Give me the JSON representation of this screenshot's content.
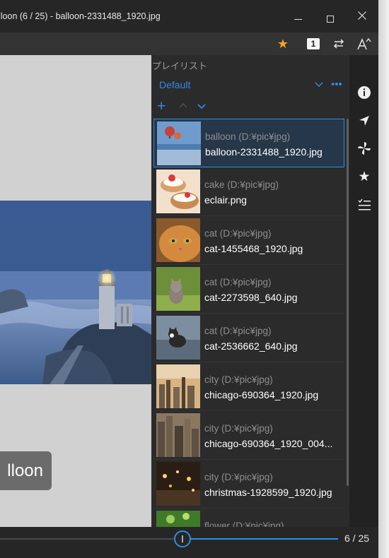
{
  "window": {
    "title": "lloon (6 / 25) - balloon-2331488_1920.jpg"
  },
  "toolbar": {
    "star_icon": "star-icon",
    "page_mode_label": "1",
    "swap_icon": "swap-direction-icon",
    "font_icon": "font-size-icon"
  },
  "viewer": {
    "caption": "lloon"
  },
  "playlist": {
    "title": "プレイリスト",
    "selected_list": "Default",
    "more_label": "•••",
    "add_label": "+",
    "items": [
      {
        "folder": "balloon (D:¥pic¥jpg)",
        "name": "balloon-2331488_1920.jpg",
        "selected": true
      },
      {
        "folder": "cake (D:¥pic¥jpg)",
        "name": "eclair.png",
        "selected": false
      },
      {
        "folder": "cat (D:¥pic¥jpg)",
        "name": "cat-1455468_1920.jpg",
        "selected": false
      },
      {
        "folder": "cat (D:¥pic¥jpg)",
        "name": "cat-2273598_640.jpg",
        "selected": false
      },
      {
        "folder": "cat (D:¥pic¥jpg)",
        "name": "cat-2536662_640.jpg",
        "selected": false
      },
      {
        "folder": "city (D:¥pic¥jpg)",
        "name": "chicago-690364_1920.jpg",
        "selected": false
      },
      {
        "folder": "city (D:¥pic¥jpg)",
        "name": "chicago-690364_1920_004...",
        "selected": false
      },
      {
        "folder": "city (D:¥pic¥jpg)",
        "name": "christmas-1928599_1920.jpg",
        "selected": false
      },
      {
        "folder": "flower (D:¥pic¥jpg)",
        "name": "",
        "selected": false
      }
    ]
  },
  "sidebar": {
    "icons": [
      "info-icon",
      "navigate-icon",
      "pinwheel-icon",
      "favorite-star-icon",
      "checklist-icon"
    ]
  },
  "slider": {
    "current": 6,
    "total": 25,
    "page_label": "6 / 25"
  },
  "colors": {
    "accent": "#2f8be6",
    "star": "#f5a623",
    "background": "#1f1f1f"
  }
}
